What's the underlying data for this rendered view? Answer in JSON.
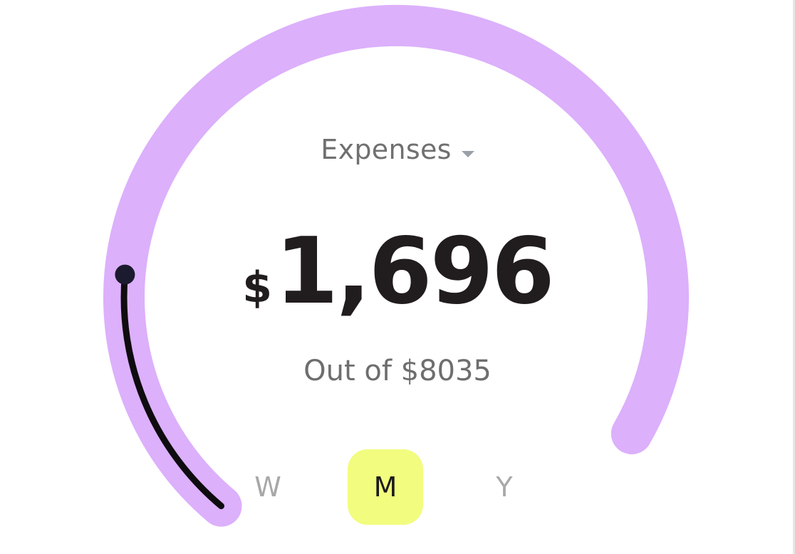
{
  "widget": {
    "metric_label": "Expenses",
    "currency_symbol": "$",
    "amount": "1,696",
    "total_text": "Out of $8035",
    "progress_fraction": 0.211,
    "track_color": "#dcb0fb",
    "progress_color": "#0f0c10",
    "knob_color": "#1b1a2e",
    "active_tab_color": "#f2fc7e"
  },
  "period_tabs": [
    {
      "label": "W",
      "active": false
    },
    {
      "label": "M",
      "active": true
    },
    {
      "label": "Y",
      "active": false
    }
  ]
}
